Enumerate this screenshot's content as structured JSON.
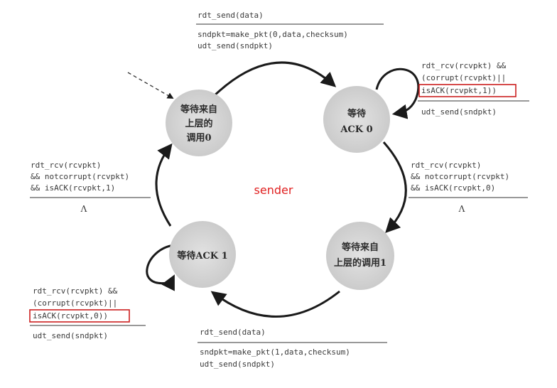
{
  "diagram": {
    "title": "sender",
    "states": [
      {
        "id": "wait-call-0",
        "lines": [
          "等待来自",
          "上层的",
          "调用0"
        ]
      },
      {
        "id": "wait-ack-0",
        "lines": [
          "等待",
          "ACK 0"
        ]
      },
      {
        "id": "wait-call-1",
        "lines": [
          "等待来自",
          "上层的调用1"
        ]
      },
      {
        "id": "wait-ack-1",
        "lines": [
          "等待ACK 1"
        ]
      }
    ],
    "transitions": {
      "call0_to_ack0": {
        "event": "rdt_send(data)",
        "actions": [
          "sndpkt=make_pkt(0,data,checksum)",
          "udt_send(sndpkt)"
        ]
      },
      "ack0_self": {
        "event": [
          "rdt_rcv(rcvpkt) &&",
          "(corrupt(rcvpkt)||"
        ],
        "event_highlight": "isACK(rcvpkt,1))",
        "actions": [
          "udt_send(sndpkt)"
        ]
      },
      "ack0_to_call1": {
        "event": [
          "rdt_rcv(rcvpkt)",
          "&& notcorrupt(rcvpkt)",
          "&& isACK(rcvpkt,0)"
        ],
        "actions": [
          "Λ"
        ]
      },
      "call1_to_ack1": {
        "event": "rdt_send(data)",
        "actions": [
          "sndpkt=make_pkt(1,data,checksum)",
          "udt_send(sndpkt)"
        ]
      },
      "ack1_self": {
        "event": [
          "rdt_rcv(rcvpkt) &&",
          "(corrupt(rcvpkt)||"
        ],
        "event_highlight": "isACK(rcvpkt,0))",
        "actions": [
          "udt_send(sndpkt)"
        ]
      },
      "ack1_to_call0": {
        "event": [
          "rdt_rcv(rcvpkt)",
          "&& notcorrupt(rcvpkt)",
          "&& isACK(rcvpkt,1)"
        ],
        "actions": [
          "Λ"
        ]
      }
    },
    "colors": {
      "state_fill": "#d6d6d6",
      "arrow": "#1a1a1a",
      "highlight_box": "#cc1f1f",
      "title": "#e02020"
    }
  }
}
